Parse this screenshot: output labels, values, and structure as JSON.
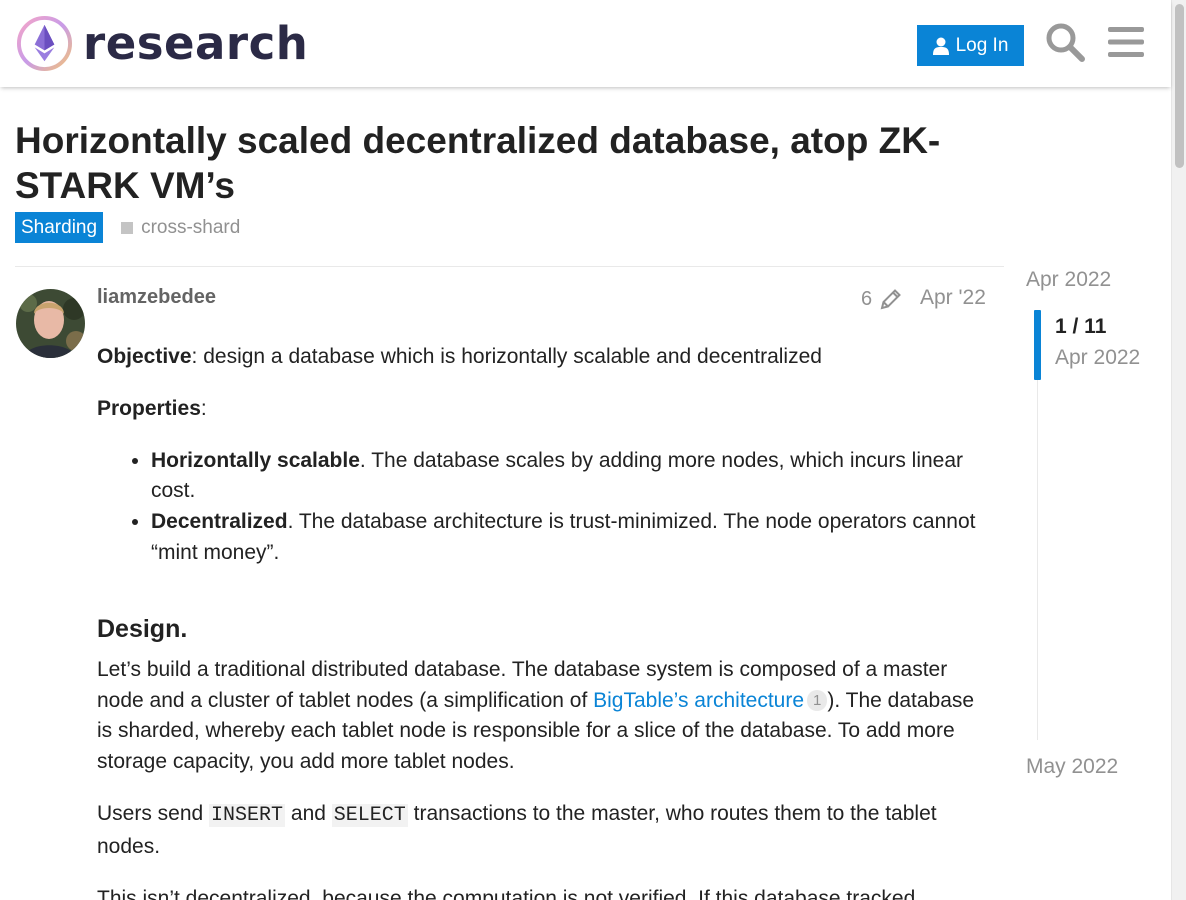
{
  "site": {
    "name": "research",
    "login_label": "Log In",
    "colors": {
      "accent": "#0a84d6",
      "text": "#222222",
      "muted": "#919191"
    }
  },
  "topic": {
    "title": "Horizontally scaled decentralized database, atop ZK-STARK VM’s",
    "category": "Sharding",
    "tags": [
      "cross-shard"
    ]
  },
  "post": {
    "author": "liamzebedee",
    "edit_count": "6",
    "date": "Apr '22",
    "objective_label": "Objective",
    "objective_text": ": design a database which is horizontally scalable and decentralized",
    "properties_label": "Properties",
    "properties_colon": ":",
    "properties": [
      {
        "name": "Horizontally scalable",
        "text": ". The database scales by adding more nodes, which incurs linear cost."
      },
      {
        "name": "Decentralized",
        "text": ". The database architecture is trust-minimized. The node operators cannot “mint money”."
      }
    ],
    "design_heading": "Design.",
    "design_p1_a": "Let’s build a traditional distributed database. The database system is composed of a master node and a cluster of tablet nodes (a simplification of ",
    "design_link": "BigTable’s architecture",
    "design_link_clicks": "1",
    "design_p1_b": "). The database is sharded, whereby each tablet node is responsible for a slice of the database. To add more storage capacity, you add more tablet nodes.",
    "design_p2_a": "Users send ",
    "code_insert": "INSERT",
    "design_p2_b": " and ",
    "code_select": "SELECT",
    "design_p2_c": " transactions to the master, who routes them to the tablet nodes.",
    "design_p3": "This isn’t decentralized, because the computation is not verified. If this database tracked"
  },
  "timeline": {
    "start": "Apr 2022",
    "position": "1 / 11",
    "current_date": "Apr 2022",
    "end": "May 2022",
    "progress": 0.0909
  },
  "icons": [
    "logo-icon",
    "user-icon",
    "search-icon",
    "hamburger-menu-icon",
    "pencil-icon"
  ]
}
